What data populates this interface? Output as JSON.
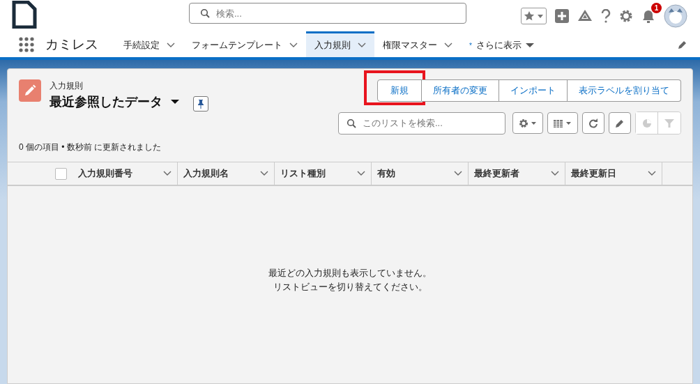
{
  "header": {
    "search_placeholder": "検索...",
    "notification_count": "1"
  },
  "nav": {
    "app_name": "カミレス",
    "tabs": [
      {
        "label": "手続設定",
        "selected": false,
        "kind": "tab"
      },
      {
        "label": "フォームテンプレート",
        "selected": false,
        "kind": "tab"
      },
      {
        "label": "入力規則",
        "selected": true,
        "kind": "tab"
      },
      {
        "label": "権限マスター",
        "selected": false,
        "kind": "tab"
      },
      {
        "label": "さらに表示",
        "selected": false,
        "kind": "more",
        "mark": "*"
      }
    ]
  },
  "list": {
    "object": "入力規則",
    "view": "最近参照したデータ",
    "status": "0 個の項目 • 数秒前 に更新されました",
    "actions": [
      {
        "label": "新規",
        "highlighted": true
      },
      {
        "label": "所有者の変更",
        "highlighted": false
      },
      {
        "label": "インポート",
        "highlighted": false
      },
      {
        "label": "表示ラベルを割り当て",
        "highlighted": false
      }
    ],
    "search_placeholder": "このリストを検索...",
    "select_all_checked": false,
    "columns": [
      "入力規則番号",
      "入力規則名",
      "リスト種別",
      "有効",
      "最終更新者",
      "最終更新日"
    ],
    "empty_message": [
      "最近どの入力規則も表示していません。",
      "リストビューを切り替えてください。"
    ]
  }
}
